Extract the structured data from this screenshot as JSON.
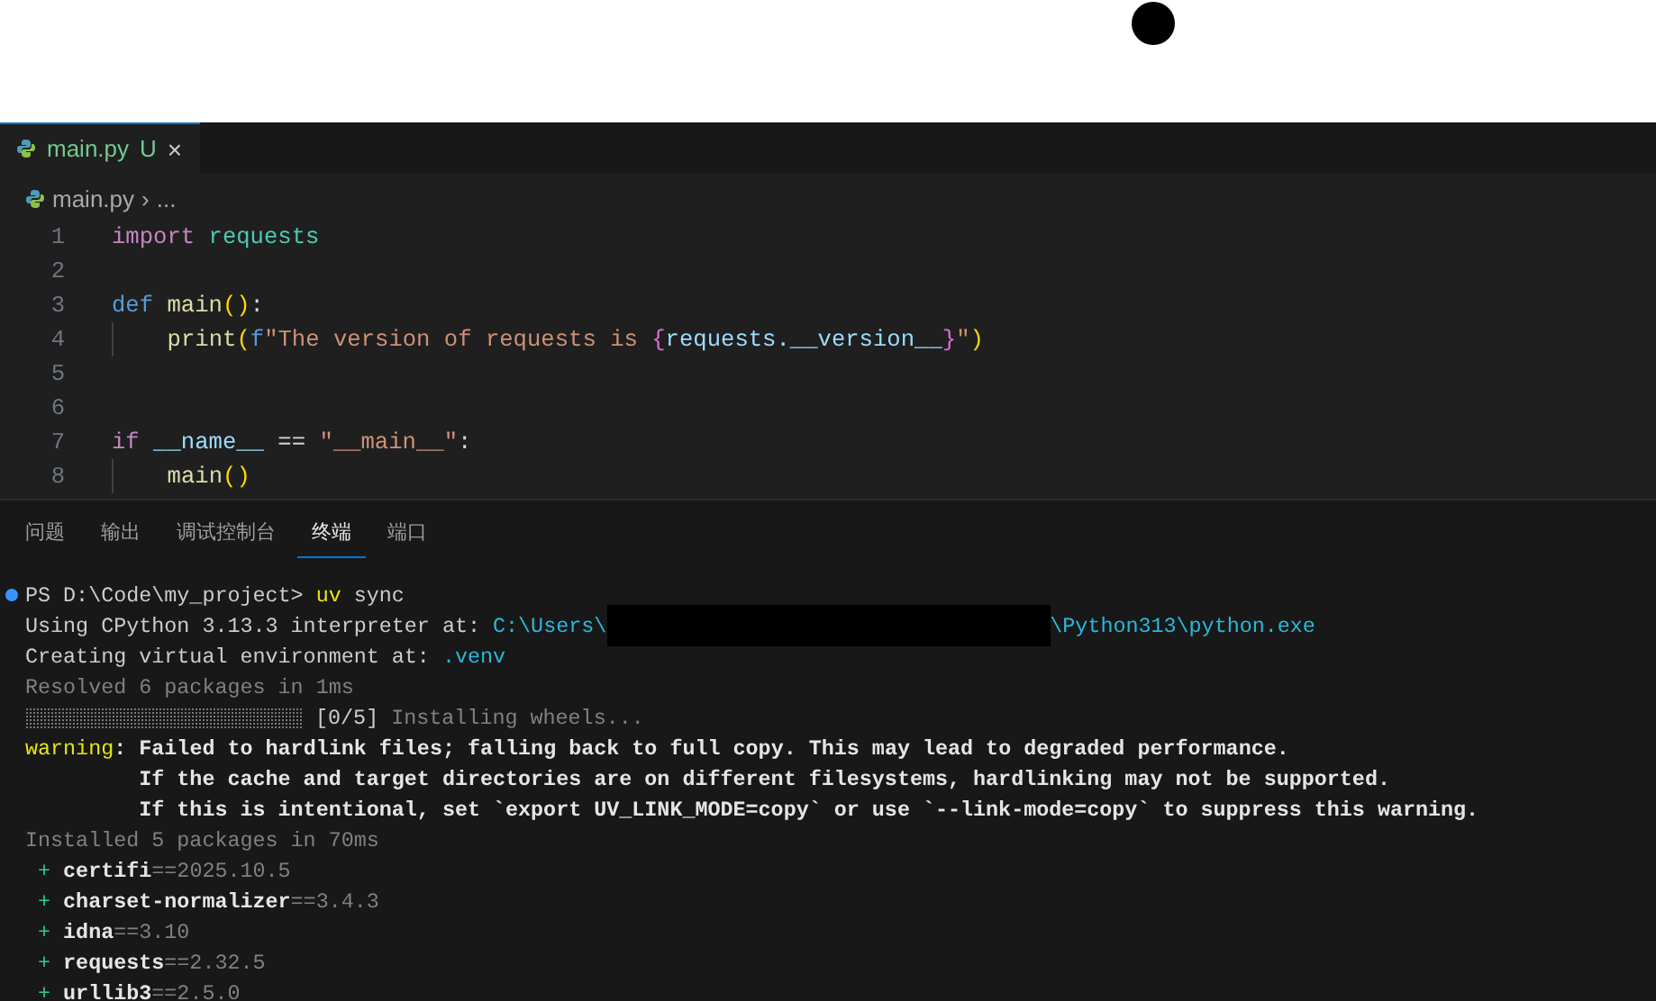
{
  "editor_tabs": [
    {
      "label": "main.py",
      "status": "U",
      "close": "×",
      "selected": true
    }
  ],
  "breadcrumb": {
    "file": "main.py",
    "separator": "›",
    "rest": "..."
  },
  "code_lines": [
    {
      "number": "1",
      "guide": false,
      "tokens": [
        {
          "text": "import ",
          "kind": "kw"
        },
        {
          "text": "requests",
          "kind": "module"
        }
      ]
    },
    {
      "number": "2",
      "guide": false
    },
    {
      "number": "3",
      "guide": false,
      "tokens": [
        {
          "text": "def ",
          "kind": "def"
        },
        {
          "text": "main",
          "kind": "func"
        },
        {
          "text": "()",
          "kind": "paren"
        },
        {
          "text": ":",
          "kind": "plain"
        }
      ]
    },
    {
      "number": "4",
      "guide": true,
      "tokens": [
        {
          "text": "print",
          "kind": "func"
        },
        {
          "text": "(",
          "kind": "paren"
        },
        {
          "text": "f",
          "kind": "def"
        },
        {
          "text": "\"The version of requests is ",
          "kind": "str"
        },
        {
          "text": "{",
          "kind": "brace"
        },
        {
          "text": "requests.__version__",
          "kind": "var"
        },
        {
          "text": "}",
          "kind": "brace"
        },
        {
          "text": "\"",
          "kind": "str"
        },
        {
          "text": ")",
          "kind": "paren"
        }
      ]
    },
    {
      "number": "5",
      "guide": false
    },
    {
      "number": "6",
      "guide": false
    },
    {
      "number": "7",
      "guide": false,
      "tokens": [
        {
          "text": "if ",
          "kind": "kw"
        },
        {
          "text": "__name__",
          "kind": "var"
        },
        {
          "text": " == ",
          "kind": "plain"
        },
        {
          "text": "\"__main__\"",
          "kind": "str"
        },
        {
          "text": ":",
          "kind": "plain"
        }
      ]
    },
    {
      "number": "8",
      "guide": true,
      "tokens": [
        {
          "text": "main",
          "kind": "func"
        },
        {
          "text": "()",
          "kind": "paren"
        }
      ]
    }
  ],
  "panel_tabs": [
    {
      "label": "问题",
      "selected": false
    },
    {
      "label": "输出",
      "selected": false
    },
    {
      "label": "调试控制台",
      "selected": false
    },
    {
      "label": "终端",
      "selected": true
    },
    {
      "label": "端口",
      "selected": false
    }
  ],
  "terminal_lines": [
    {
      "marker": true,
      "segments": [
        {
          "text": "PS D:\\Code\\my_project> ",
          "kind": "plain"
        },
        {
          "text": "uv",
          "kind": "cmd"
        },
        {
          "text": " sync",
          "kind": "plain"
        }
      ]
    },
    {
      "marker": false,
      "segments": [
        {
          "text": "Using CPython 3.13.3 interpreter at: ",
          "kind": "plain"
        },
        {
          "text": "C:\\Users\\",
          "kind": "path"
        },
        {
          "kind": "redacted"
        },
        {
          "text": "\\Python313\\python.exe",
          "kind": "path"
        }
      ]
    },
    {
      "marker": false,
      "segments": [
        {
          "text": "Creating virtual environment at: ",
          "kind": "plain"
        },
        {
          "text": ".venv",
          "kind": "path"
        }
      ]
    },
    {
      "marker": false,
      "segments": [
        {
          "text": "Resolved 6 packages in 1ms",
          "kind": "dim"
        }
      ]
    },
    {
      "marker": false,
      "segments": [
        {
          "kind": "progress",
          "level": 0
        },
        {
          "text": " [0/5]",
          "kind": "plain"
        },
        {
          "text": " Installing wheels...",
          "kind": "dim"
        }
      ]
    },
    {
      "marker": false,
      "segments": [
        {
          "text": "warning",
          "kind": "warn"
        },
        {
          "text": ": Failed to hardlink files; falling back to full copy. This may lead to degraded performance.",
          "kind": "bold"
        }
      ]
    },
    {
      "marker": false,
      "segments": [
        {
          "text": "         If the cache and target directories are on different filesystems, hardlinking may not be supported.",
          "kind": "bold"
        }
      ]
    },
    {
      "marker": false,
      "segments": [
        {
          "text": "         If this is intentional, set `export UV_LINK_MODE=copy` or use `--link-mode=copy` to suppress this warning.",
          "kind": "bold"
        }
      ]
    },
    {
      "marker": false,
      "segments": [
        {
          "text": "Installed 5 packages in 70ms",
          "kind": "dim"
        }
      ]
    },
    {
      "marker": false,
      "segments": [
        {
          "text": " + ",
          "kind": "add"
        },
        {
          "text": "certifi",
          "kind": "bold"
        },
        {
          "text": "==2025.10.5",
          "kind": "dim"
        }
      ]
    },
    {
      "marker": false,
      "segments": [
        {
          "text": " + ",
          "kind": "add"
        },
        {
          "text": "charset-normalizer",
          "kind": "bold"
        },
        {
          "text": "==3.4.3",
          "kind": "dim"
        }
      ]
    },
    {
      "marker": false,
      "segments": [
        {
          "text": " + ",
          "kind": "add"
        },
        {
          "text": "idna",
          "kind": "bold"
        },
        {
          "text": "==3.10",
          "kind": "dim"
        }
      ]
    },
    {
      "marker": false,
      "segments": [
        {
          "text": " + ",
          "kind": "add"
        },
        {
          "text": "requests",
          "kind": "bold"
        },
        {
          "text": "==2.32.5",
          "kind": "dim"
        }
      ]
    },
    {
      "marker": false,
      "segments": [
        {
          "text": " + ",
          "kind": "add"
        },
        {
          "text": "urllib3",
          "kind": "bold"
        },
        {
          "text": "==2.5.0",
          "kind": "dim"
        }
      ]
    }
  ]
}
